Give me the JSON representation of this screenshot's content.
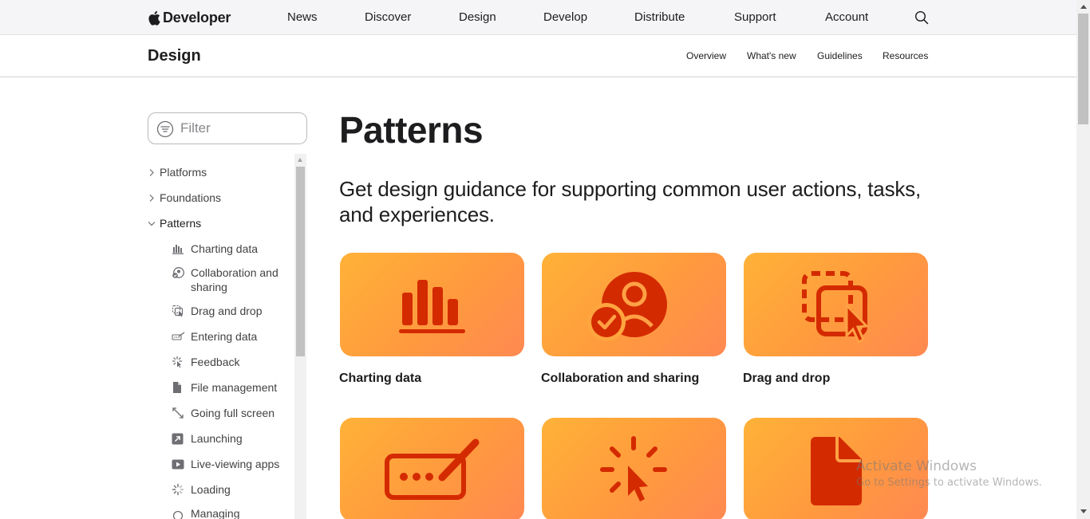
{
  "globalnav": {
    "brand": "Developer",
    "links": [
      "News",
      "Discover",
      "Design",
      "Develop",
      "Distribute",
      "Support",
      "Account"
    ]
  },
  "localnav": {
    "title": "Design",
    "links": [
      "Overview",
      "What's new",
      "Guidelines",
      "Resources"
    ]
  },
  "filter": {
    "placeholder": "Filter"
  },
  "sidebar": {
    "sections": [
      {
        "label": "Platforms",
        "expanded": false
      },
      {
        "label": "Foundations",
        "expanded": false
      },
      {
        "label": "Patterns",
        "expanded": true
      }
    ],
    "items": [
      {
        "label": "Charting data",
        "icon": "chart-bars-icon"
      },
      {
        "label": "Collaboration and sharing",
        "icon": "person-check-icon"
      },
      {
        "label": "Drag and drop",
        "icon": "drag-drop-icon"
      },
      {
        "label": "Entering data",
        "icon": "pencil-field-icon"
      },
      {
        "label": "Feedback",
        "icon": "feedback-burst-icon"
      },
      {
        "label": "File management",
        "icon": "document-icon"
      },
      {
        "label": "Going full screen",
        "icon": "expand-arrows-icon"
      },
      {
        "label": "Launching",
        "icon": "launch-arrow-icon"
      },
      {
        "label": "Live-viewing apps",
        "icon": "play-rect-icon"
      },
      {
        "label": "Loading",
        "icon": "spinner-icon"
      },
      {
        "label": "Managing",
        "icon": "person-gear-icon"
      }
    ]
  },
  "main": {
    "title": "Patterns",
    "lead": "Get design guidance for supporting common user actions, tasks, and experiences.",
    "cards": [
      {
        "label": "Charting data",
        "icon": "chart-bars-icon"
      },
      {
        "label": "Collaboration and sharing",
        "icon": "person-check-icon"
      },
      {
        "label": "Drag and drop",
        "icon": "drag-drop-icon"
      },
      {
        "label": "",
        "icon": "pencil-field-icon"
      },
      {
        "label": "",
        "icon": "feedback-cursor-icon"
      },
      {
        "label": "",
        "icon": "document-icon"
      }
    ]
  },
  "watermark": {
    "line1": "Activate Windows",
    "line2": "Go to Settings to activate Windows."
  },
  "colors": {
    "card_gradient_start": "#ffb238",
    "card_gradient_end": "#ff8952",
    "card_glyph": "#d42a00",
    "text": "#1d1d1f",
    "nav_bg": "#f5f5f7"
  }
}
